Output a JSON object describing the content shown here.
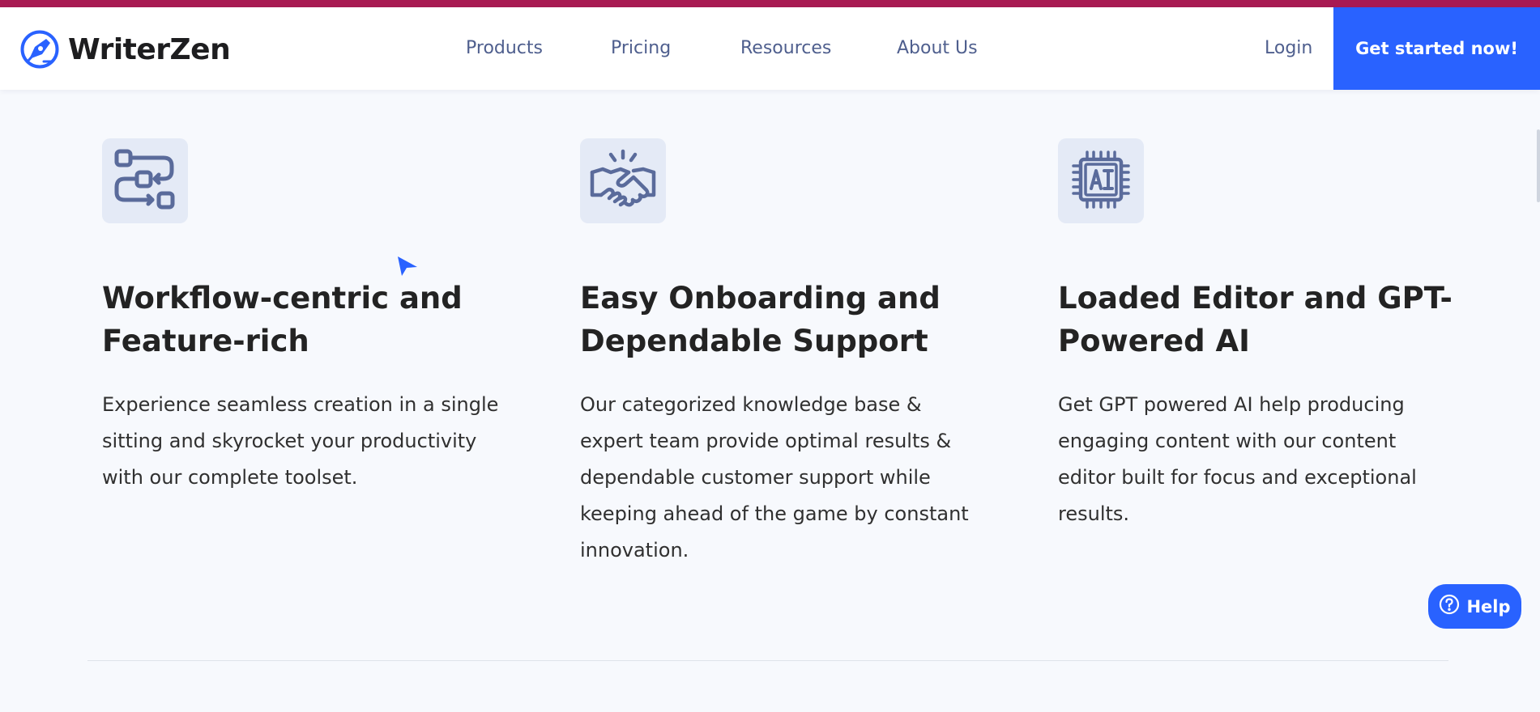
{
  "brand": {
    "name": "WriterZen",
    "color": "#2962ff",
    "accent_stripe": "#a81a52"
  },
  "nav": {
    "items": [
      {
        "label": "Products"
      },
      {
        "label": "Pricing"
      },
      {
        "label": "Resources"
      },
      {
        "label": "About Us"
      }
    ],
    "login_label": "Login",
    "cta_label": "Get started now!"
  },
  "features": [
    {
      "icon": "workflow-icon",
      "title": "Workflow-centric and Feature-rich",
      "description": "Experience seamless creation in a single sitting and skyrocket your productivity with our complete toolset."
    },
    {
      "icon": "handshake-icon",
      "title": "Easy Onboarding and Dependable Support",
      "description": "Our categorized knowledge base & expert team provide optimal results & dependable customer support while keeping ahead of the game by constant innovation."
    },
    {
      "icon": "ai-chip-icon",
      "title": "Loaded Editor and GPT-Powered AI",
      "description": "Get GPT powered AI help producing engaging content with our content editor built for focus and exceptional results."
    }
  ],
  "help": {
    "label": "Help",
    "icon": "question-circle-icon"
  },
  "colors": {
    "page_background": "#f7f9fd",
    "icon_stroke": "#5a6b9b",
    "icon_box": "#e4eaf6",
    "nav_text": "#4f5f8e"
  }
}
